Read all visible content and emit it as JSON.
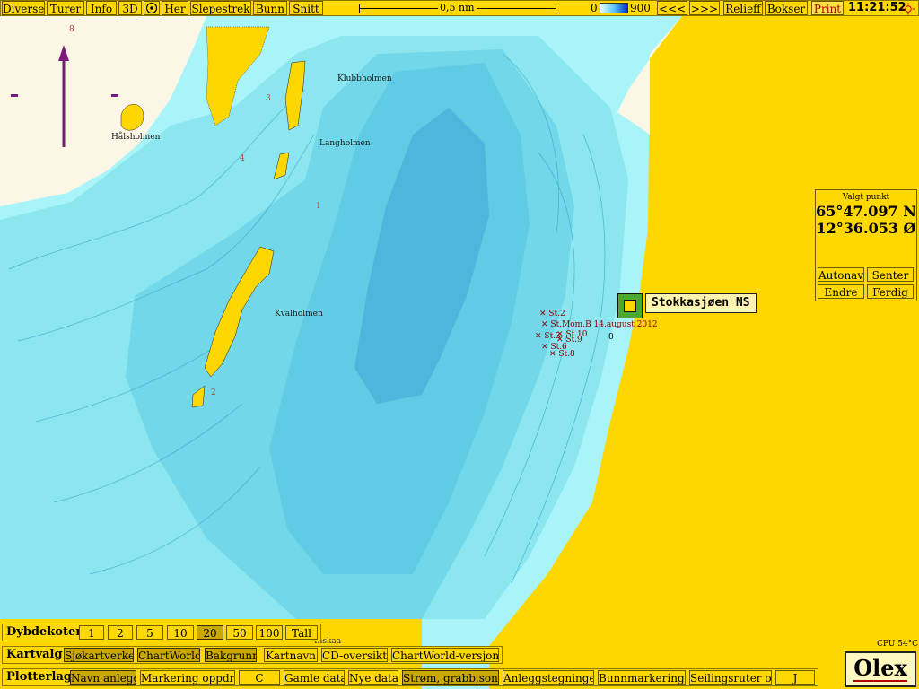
{
  "toolbar": {
    "buttons": [
      "Diverse",
      "Turer",
      "Info",
      "3D",
      "Her",
      "Slepestrek",
      "Bunn",
      "Snitt"
    ],
    "scale_label": "0,5 nm",
    "depth_min": "0",
    "depth_max": "900",
    "nav_left": "<<<",
    "nav_right": ">>>",
    "relieff": "Relieff",
    "bokser": "Bokser",
    "print": "Print",
    "clock": "11:21:52"
  },
  "compass": {
    "north_digit": "8"
  },
  "selected_point": {
    "title": "Valgt punkt",
    "lat": "65°47.097 N",
    "lon": "12°36.053 Ø",
    "buttons": [
      "Autonav",
      "Senter",
      "Endre",
      "Ferdig"
    ]
  },
  "station": {
    "name": "Stokkasjøen NS"
  },
  "map_labels": [
    "Klubbholmen",
    "Hålsholmen",
    "Langholmen",
    "Kvalholmen"
  ],
  "map_numbers": [
    "3",
    "4",
    "1",
    "2"
  ],
  "waypoints": [
    "St.2",
    "St.Mom.B 14.august 2012",
    "St.10",
    "St.3",
    "St.9",
    "St.6",
    "St.8",
    "0"
  ],
  "bottom_edge_label": "Inskaa",
  "cpu": "CPU 54°C",
  "brand": "Olex",
  "dybdekoter": {
    "label": "Dybdekoter",
    "options": [
      "1",
      "2",
      "5",
      "10",
      "20",
      "50",
      "100",
      "Tall"
    ],
    "selected": "20"
  },
  "kartvalg": {
    "label": "Kartvalg",
    "options": [
      "Sjøkartverket",
      "ChartWorld",
      "Bakgrunn",
      "Kartnavn",
      "CD-oversikt",
      "ChartWorld-versjoner"
    ]
  },
  "plotterlag": {
    "label": "Plotterlag",
    "options": [
      "Navn anlegg",
      "Markering oppdrett",
      "C",
      "Gamle data",
      "Nye data",
      "Strøm, grabb,sonde",
      "Anleggstegninger",
      "Bunnmarkeringer",
      "Seilingsruter o.l.",
      "J"
    ]
  },
  "colors": {
    "land": "#ffd700",
    "shallow": "#a8f4f8",
    "mid": "#7ee0ec",
    "deep": "#5cc7e2",
    "deepest": "#4bb3db",
    "accent_red": "#b00000",
    "panel": "#ffd800"
  }
}
